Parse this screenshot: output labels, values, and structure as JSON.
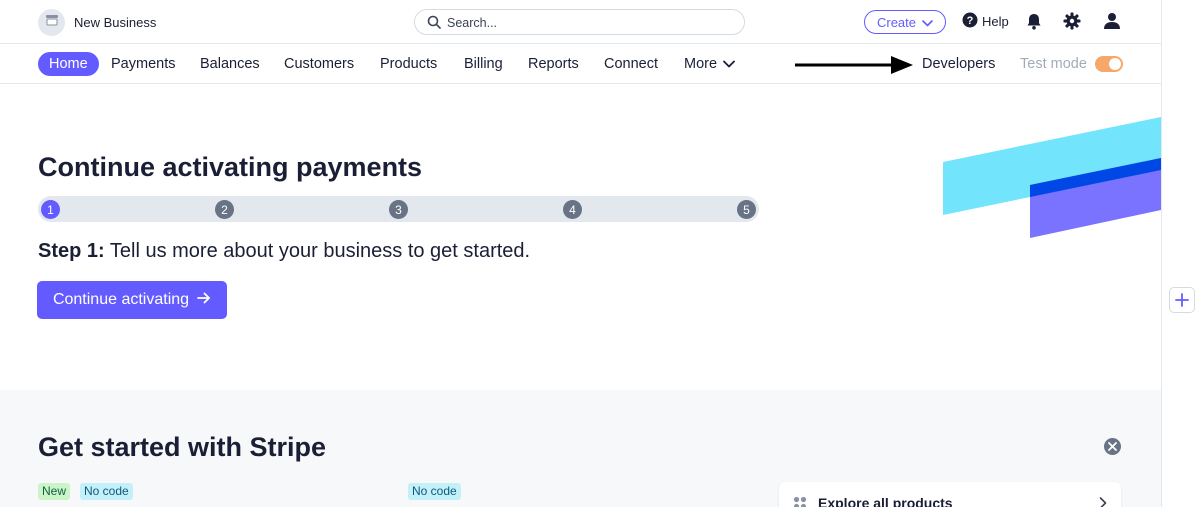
{
  "topbar": {
    "business_name": "New Business",
    "search_placeholder": "Search...",
    "create_label": "Create",
    "help_label": "Help",
    "icons": [
      "store-icon",
      "search-icon",
      "chevron-down-icon",
      "help-icon",
      "bell-icon",
      "gear-icon",
      "user-icon"
    ]
  },
  "nav": {
    "items": [
      {
        "label": "Home",
        "active": true
      },
      {
        "label": "Payments"
      },
      {
        "label": "Balances"
      },
      {
        "label": "Customers"
      },
      {
        "label": "Products"
      },
      {
        "label": "Billing"
      },
      {
        "label": "Reports"
      },
      {
        "label": "Connect"
      },
      {
        "label": "More"
      }
    ],
    "developers_label": "Developers",
    "test_mode_label": "Test mode",
    "test_mode_on": true
  },
  "activation": {
    "title": "Continue activating payments",
    "steps": [
      "1",
      "2",
      "3",
      "4",
      "5"
    ],
    "current_step": 1,
    "step_prefix": "Step 1:",
    "step_text": " Tell us more about your business to get started.",
    "button_label": "Continue activating"
  },
  "get_started": {
    "title": "Get started with Stripe",
    "badge_new": "New",
    "badge_nocode_1": "No code",
    "badge_nocode_2": "No code",
    "explore_label": "Explore all products"
  },
  "colors": {
    "accent": "#635bff",
    "deco_cyan": "#72e4fc",
    "deco_blue": "#0048e5",
    "deco_purple": "#7a73ff",
    "toggle": "#f5a86a"
  }
}
